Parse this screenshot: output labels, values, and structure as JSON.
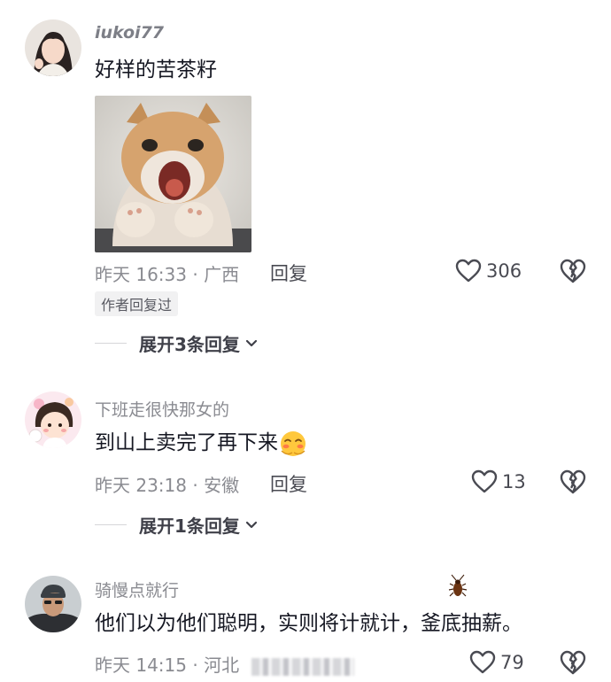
{
  "comments": [
    {
      "username": "iukoi77",
      "text": "好样的苦茶籽",
      "meta": "昨天 16:33 · 广西",
      "reply_label": "回复",
      "likes": "306",
      "badge": "作者回复过",
      "expand_label": "展开3条回复"
    },
    {
      "username": "下班走很快那女的",
      "text": "到山上卖完了再下来",
      "meta": "昨天 23:18 · 安徽",
      "reply_label": "回复",
      "likes": "13",
      "expand_label": "展开1条回复"
    },
    {
      "username": "骑慢点就行",
      "text": "他们以为他们聪明，实则将计就计，釜底抽薪。",
      "meta": "昨天 14:15 · 河北",
      "likes": "79"
    }
  ],
  "icons": {
    "like": "heart-outline-icon",
    "dislike": "broken-heart-icon",
    "expand": "chevron-down-icon"
  },
  "colors": {
    "text_primary": "#161823",
    "text_secondary": "#8a8b91",
    "accent_blush": "#ff7a45"
  }
}
